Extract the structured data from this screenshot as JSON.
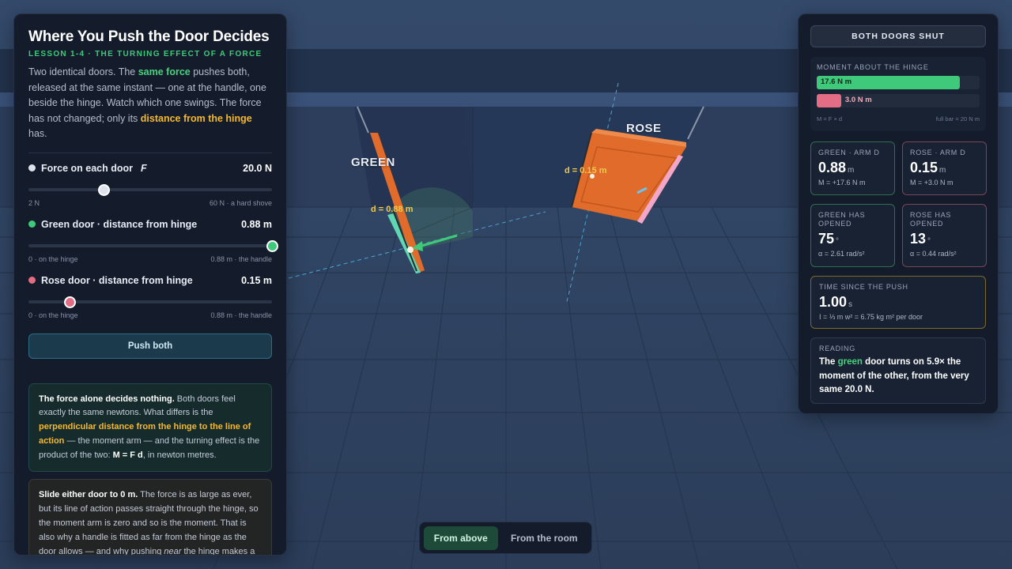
{
  "scene": {
    "green_label": "GREEN",
    "rose_label": "ROSE",
    "green_arm_label": "d = 0.88 m",
    "rose_arm_label": "d = 0.15 m"
  },
  "left_panel": {
    "title": "Where You Push the Door Decides",
    "lesson": "LESSON 1-4 · THE TURNING EFFECT OF A FORCE",
    "intro": {
      "p1": "Two identical doors. The ",
      "hl1": "same force",
      "p2": " pushes both, released at the same instant — one at the handle, one beside the hinge. Watch which one swings. The force has not changed; only its ",
      "hl2": "distance from the hinge",
      "p3": " has."
    },
    "controls": [
      {
        "label": "Force on each door",
        "symbol": "F",
        "value": "20.0 N",
        "min_label": "2 N",
        "max_label": "60 N · a hard shove",
        "color": "#dde3ec",
        "fraction": 0.31
      },
      {
        "label": "Green door · distance from hinge",
        "symbol": "",
        "value": "0.88 m",
        "min_label": "0 · on the hinge",
        "max_label": "0.88 m · the handle",
        "color": "#3fc97a",
        "fraction": 1.0
      },
      {
        "label": "Rose door · distance from hinge",
        "symbol": "",
        "value": "0.15 m",
        "min_label": "0 · on the hinge",
        "max_label": "0.88 m · the handle",
        "color": "#e36d84",
        "fraction": 0.17
      }
    ],
    "push_button": "Push both",
    "note1": {
      "bold": "The force alone decides nothing.",
      "t1": " Both doors feel exactly the same newtons. What differs is the ",
      "hl": "perpendicular distance from the hinge to the line of action",
      "t2": " — the moment arm — and the turning effect is the product of the two: ",
      "formula": "M = F d",
      "t3": ", in newton metres."
    },
    "note2": {
      "bold": "Slide either door to 0 m.",
      "t1": " The force is as large as ever, but its line of action passes straight through the hinge, so the moment arm is zero and so is the moment. That is also why a handle is fitted as far from the hinge as the door allows — and why pushing ",
      "em": "near",
      "t2": " the hinge makes a door harder to open, not easier."
    }
  },
  "right_panel": {
    "status": "BOTH DOORS SHUT",
    "moment_title": "MOMENT ABOUT THE HINGE",
    "green_moment": "17.6 N m",
    "rose_moment": "3.0 N m",
    "green_fraction": 0.88,
    "rose_fraction": 0.15,
    "formula_note": "M = F × d",
    "scale_note": "full bar = 20 N m",
    "cards": [
      {
        "title": "GREEN · ARM D",
        "value": "0.88",
        "unit": "m",
        "sub": "M = +17.6 N m",
        "tone": "green"
      },
      {
        "title": "ROSE · ARM D",
        "value": "0.15",
        "unit": "m",
        "sub": "M = +3.0 N m",
        "tone": "rose"
      },
      {
        "title": "GREEN HAS OPENED",
        "value": "75",
        "unit": "°",
        "sub": "α = 2.61 rad/s²",
        "tone": "green"
      },
      {
        "title": "ROSE HAS OPENED",
        "value": "13",
        "unit": "°",
        "sub": "α = 0.44 rad/s²",
        "tone": "rose"
      }
    ],
    "time_title": "TIME SINCE THE PUSH",
    "time_value": "1.00",
    "time_unit": "s",
    "time_sub": "I = ⅓ m w² = 6.75 kg m² per door",
    "reading_title": "READING",
    "reading_pre": "The ",
    "reading_green": "green",
    "reading_post": " door turns on 5.9× the moment of the other, from the very same 20.0 N."
  },
  "view_switch": {
    "active": "From above",
    "inactive": "From the room"
  },
  "colors": {
    "green": "#3fc97a",
    "rose": "#e36d84",
    "amber": "#f5b82e",
    "door": "#e36d2a"
  }
}
